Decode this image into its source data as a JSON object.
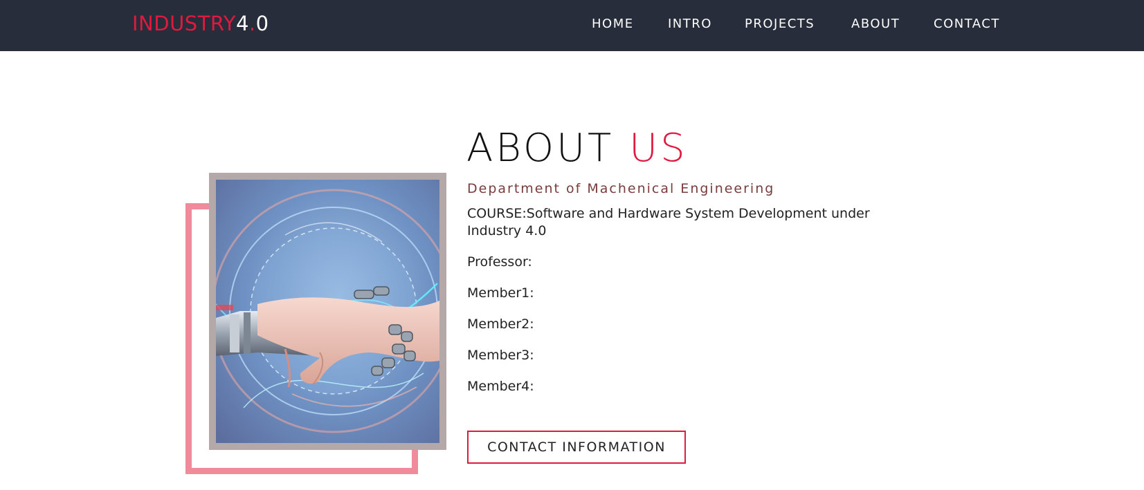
{
  "header": {
    "logo_brand": "INDUSTRY",
    "logo_version_a": "4",
    "logo_dot": ".",
    "logo_version_b": "0",
    "nav": [
      {
        "label": "HOME"
      },
      {
        "label": "INTRO"
      },
      {
        "label": "PROJECTS"
      },
      {
        "label": "ABOUT"
      },
      {
        "label": "CONTACT"
      }
    ]
  },
  "about": {
    "title_main": "ABOUT",
    "title_accent": "US",
    "department": "Department of Machenical Engineering",
    "course": "COURSE:Software and Hardware System Development under Industry 4.0",
    "professor": "Professor:",
    "members": [
      "Member1:",
      "Member2:",
      "Member3:",
      "Member4:"
    ],
    "contact_button": "CONTACT INFORMATION",
    "image_icon": "robot-human-handshake-image"
  },
  "colors": {
    "navbar_bg": "#272d3a",
    "accent": "#e0193f",
    "frame_pink": "#ef8b9b",
    "frame_gray": "#b4a8a8",
    "subtitle": "#7a3b3b"
  }
}
